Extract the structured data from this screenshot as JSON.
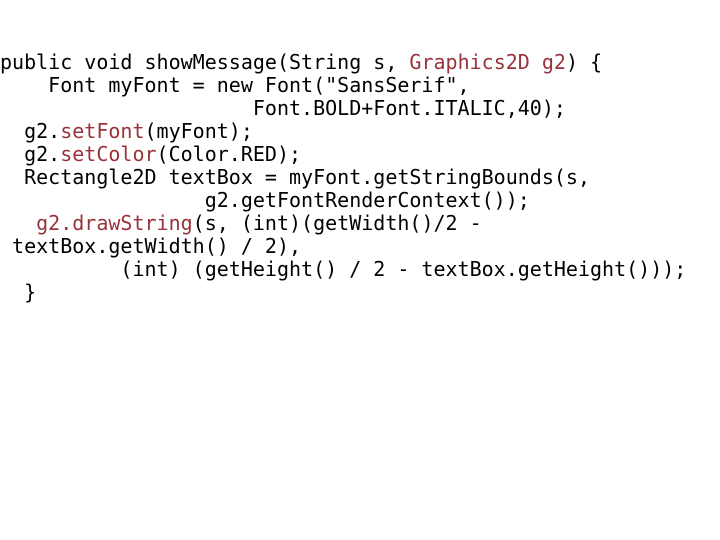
{
  "slide": {
    "background_color": "#ffffff",
    "text_color": "#000000",
    "accent_color": "#99333b",
    "language": "java",
    "title": ""
  },
  "code": {
    "full_text": "public void showMessage(String s, Graphics2D g2) {\n    Font myFont = new Font(\"SansSerif\",\n                     Font.BOLD+Font.ITALIC,40);\n  g2.setFont(myFont);\n  g2.setColor(Color.RED);\n  Rectangle2D textBox = myFont.getStringBounds(s,\n                 g2.getFontRenderContext());\n   g2.drawString(s, (int)(getWidth()/2 -\n textBox.getWidth() / 2),\n          (int) (getHeight() / 2 - textBox.getHeight()));\n  }",
    "lines": [
      {
        "id": "line-1",
        "segments": [
          {
            "text": "public void showMessage(String s, ",
            "style": "plain"
          },
          {
            "text": "Graphics2D g2",
            "style": "api"
          },
          {
            "text": ") {",
            "style": "plain"
          }
        ]
      },
      {
        "id": "line-2",
        "segments": [
          {
            "text": "    Font myFont = new Font(\"SansSerif\",",
            "style": "plain"
          }
        ]
      },
      {
        "id": "line-3",
        "segments": [
          {
            "text": "                     Font.BOLD+Font.ITALIC,40);",
            "style": "plain"
          }
        ]
      },
      {
        "id": "line-4",
        "segments": [
          {
            "text": "  g2.",
            "style": "plain"
          },
          {
            "text": "setFont",
            "style": "api"
          },
          {
            "text": "(myFont);",
            "style": "plain"
          }
        ]
      },
      {
        "id": "line-5",
        "segments": [
          {
            "text": "  g2.",
            "style": "plain"
          },
          {
            "text": "setColor",
            "style": "api"
          },
          {
            "text": "(Color.RED);",
            "style": "plain"
          }
        ]
      },
      {
        "id": "line-6",
        "segments": [
          {
            "text": "  Rectangle2D textBox = myFont.getStringBounds(s,",
            "style": "plain"
          }
        ]
      },
      {
        "id": "line-7",
        "segments": [
          {
            "text": "                 g2.getFontRenderContext());",
            "style": "plain"
          }
        ]
      },
      {
        "id": "line-8",
        "segments": [
          {
            "text": "   ",
            "style": "plain"
          },
          {
            "text": "g2.drawString",
            "style": "api"
          },
          {
            "text": "(s, (int)(getWidth()/2 -",
            "style": "plain"
          }
        ]
      },
      {
        "id": "line-9",
        "segments": [
          {
            "text": " textBox.getWidth() / 2),",
            "style": "plain"
          }
        ]
      },
      {
        "id": "line-10",
        "segments": [
          {
            "text": "          (int) (getHeight() / 2 - textBox.getHeight()));",
            "style": "plain"
          }
        ]
      },
      {
        "id": "line-11",
        "segments": [
          {
            "text": "  }",
            "style": "plain"
          }
        ]
      }
    ]
  }
}
